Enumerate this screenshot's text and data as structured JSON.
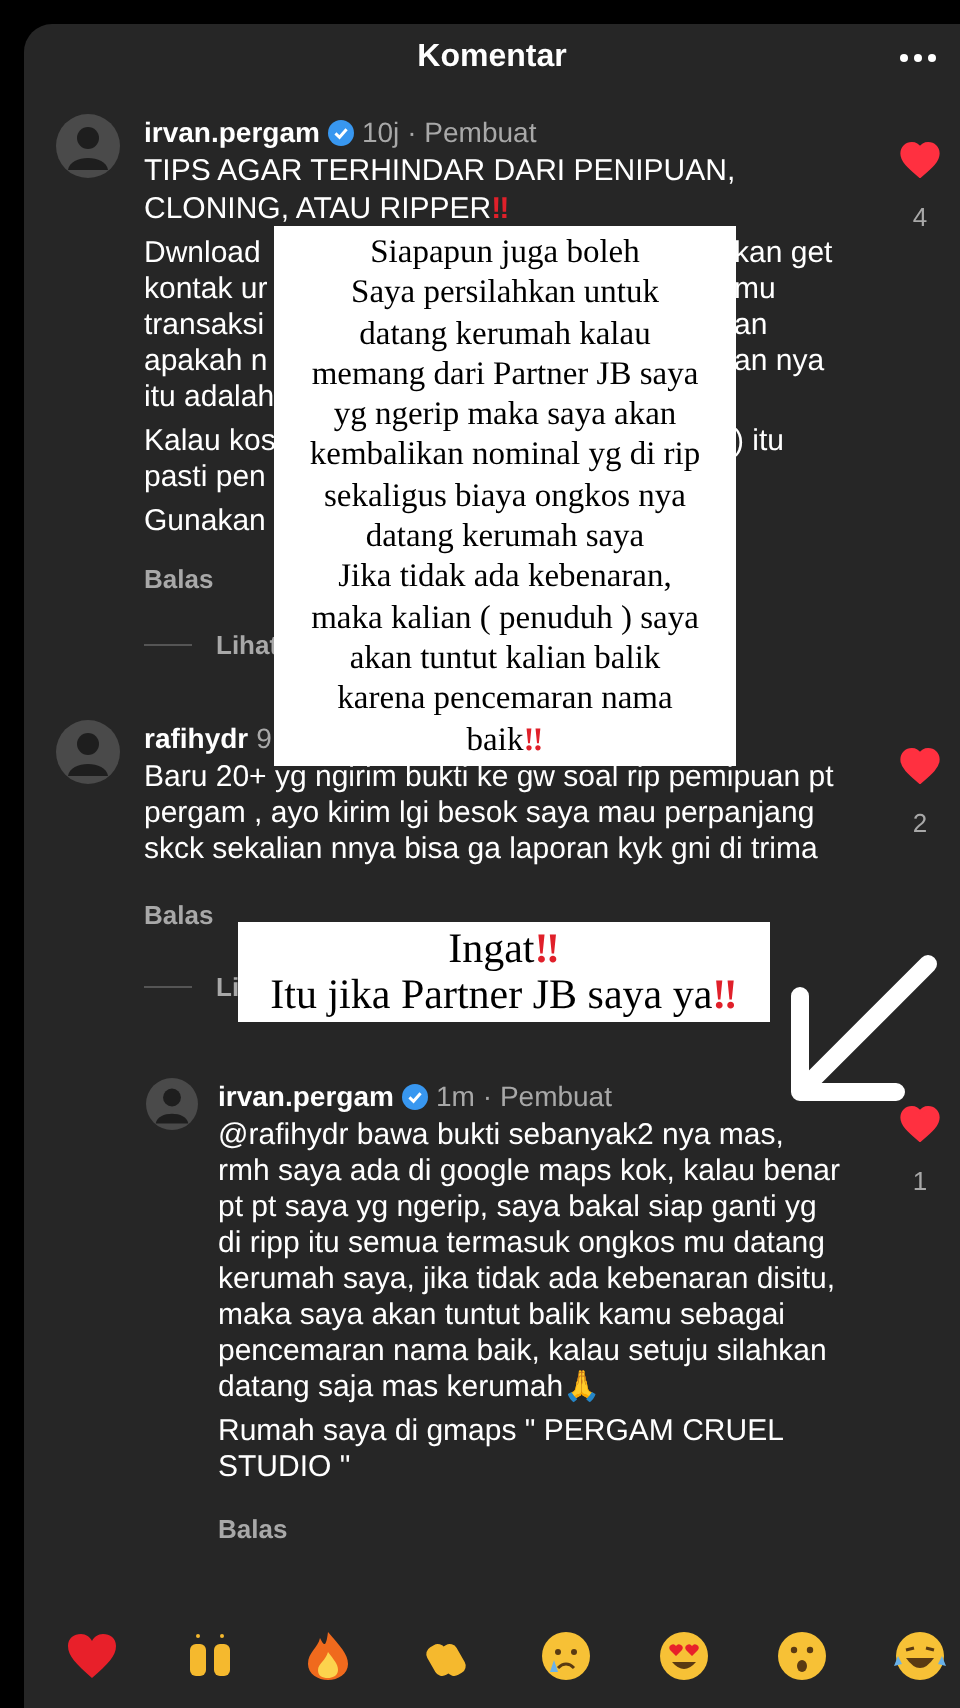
{
  "header": {
    "title": "Komentar"
  },
  "comments": [
    {
      "username": "irvan.pergam",
      "verified": true,
      "time": "10j",
      "tag": "· Pembuat",
      "title": {
        "text": "TIPS AGAR TERHINDAR DARI PENIPUAN, CLONING, ATAU RIPPER",
        "mark": "‼"
      },
      "paragraphs": [
        [
          {
            "left": "Dwnload",
            "right": "kan get"
          },
          {
            "left": "kontak ur",
            "right": "mu"
          },
          {
            "left": "transaksi",
            "right": "an"
          },
          {
            "left": "apakah n",
            "right": "an nya"
          },
          {
            "left": "itu adalah"
          }
        ],
        [
          {
            "left": "Kalau kos",
            "right": ") itu"
          },
          {
            "left": "pasti pen"
          }
        ],
        [
          {
            "left": "Gunakan"
          }
        ]
      ],
      "reply_label": "Balas",
      "view_replies": "Lihat",
      "liked": true,
      "likes": "4"
    },
    {
      "username": "rafihydr",
      "time": "9",
      "text": "Baru 20+ yg ngirim bukti ke gw soal rip pemipuan pt pergam , ayo kirim lgi besok saya mau perpanjang skck sekalian nnya bisa ga laporan kyk gni di trima",
      "reply_label": "Balas",
      "view_replies": "Li",
      "liked": true,
      "likes": "2",
      "replies": [
        {
          "username": "irvan.pergam",
          "verified": true,
          "time": "1m",
          "tag": "· Pembuat",
          "text": "@rafihydr bawa bukti sebanyak2 nya mas, rmh saya ada di google maps kok, kalau benar pt pt saya yg ngerip, saya bakal siap ganti yg di ripp itu semua termasuk ongkos mu datang kerumah saya, jika tidak ada kebenaran disitu, maka saya akan tuntut balik kamu sebagai pencemaran nama baik, kalau setuju silahkan datang saja mas kerumah🙏",
          "extra": "Rumah saya di gmaps \" PERGAM CRUEL STUDIO \"",
          "reply_label": "Balas",
          "liked": true,
          "likes": "1"
        }
      ]
    }
  ],
  "overlays": [
    {
      "lines": [
        {
          "text": "Siapapun juga boleh"
        },
        {
          "text": "Saya persilahkan untuk"
        },
        {
          "text": "datang kerumah kalau"
        },
        {
          "text": "memang dari Partner JB saya"
        },
        {
          "text": "yg ngerip maka saya akan"
        },
        {
          "text": "kembalikan nominal yg di rip"
        },
        {
          "text": "sekaligus biaya ongkos nya"
        },
        {
          "text": "datang kerumah saya"
        },
        {
          "text": "Jika tidak ada kebenaran,"
        },
        {
          "text": "maka kalian ( penuduh ) saya"
        },
        {
          "text": "akan tuntut kalian balik"
        },
        {
          "text": "karena pencemaran nama"
        },
        {
          "text": "baik",
          "mark": "‼"
        }
      ]
    },
    {
      "lines": [
        {
          "text": "Ingat",
          "mark": "‼"
        },
        {
          "text": "Itu jika Partner JB saya ya",
          "mark": "‼"
        }
      ]
    }
  ]
}
